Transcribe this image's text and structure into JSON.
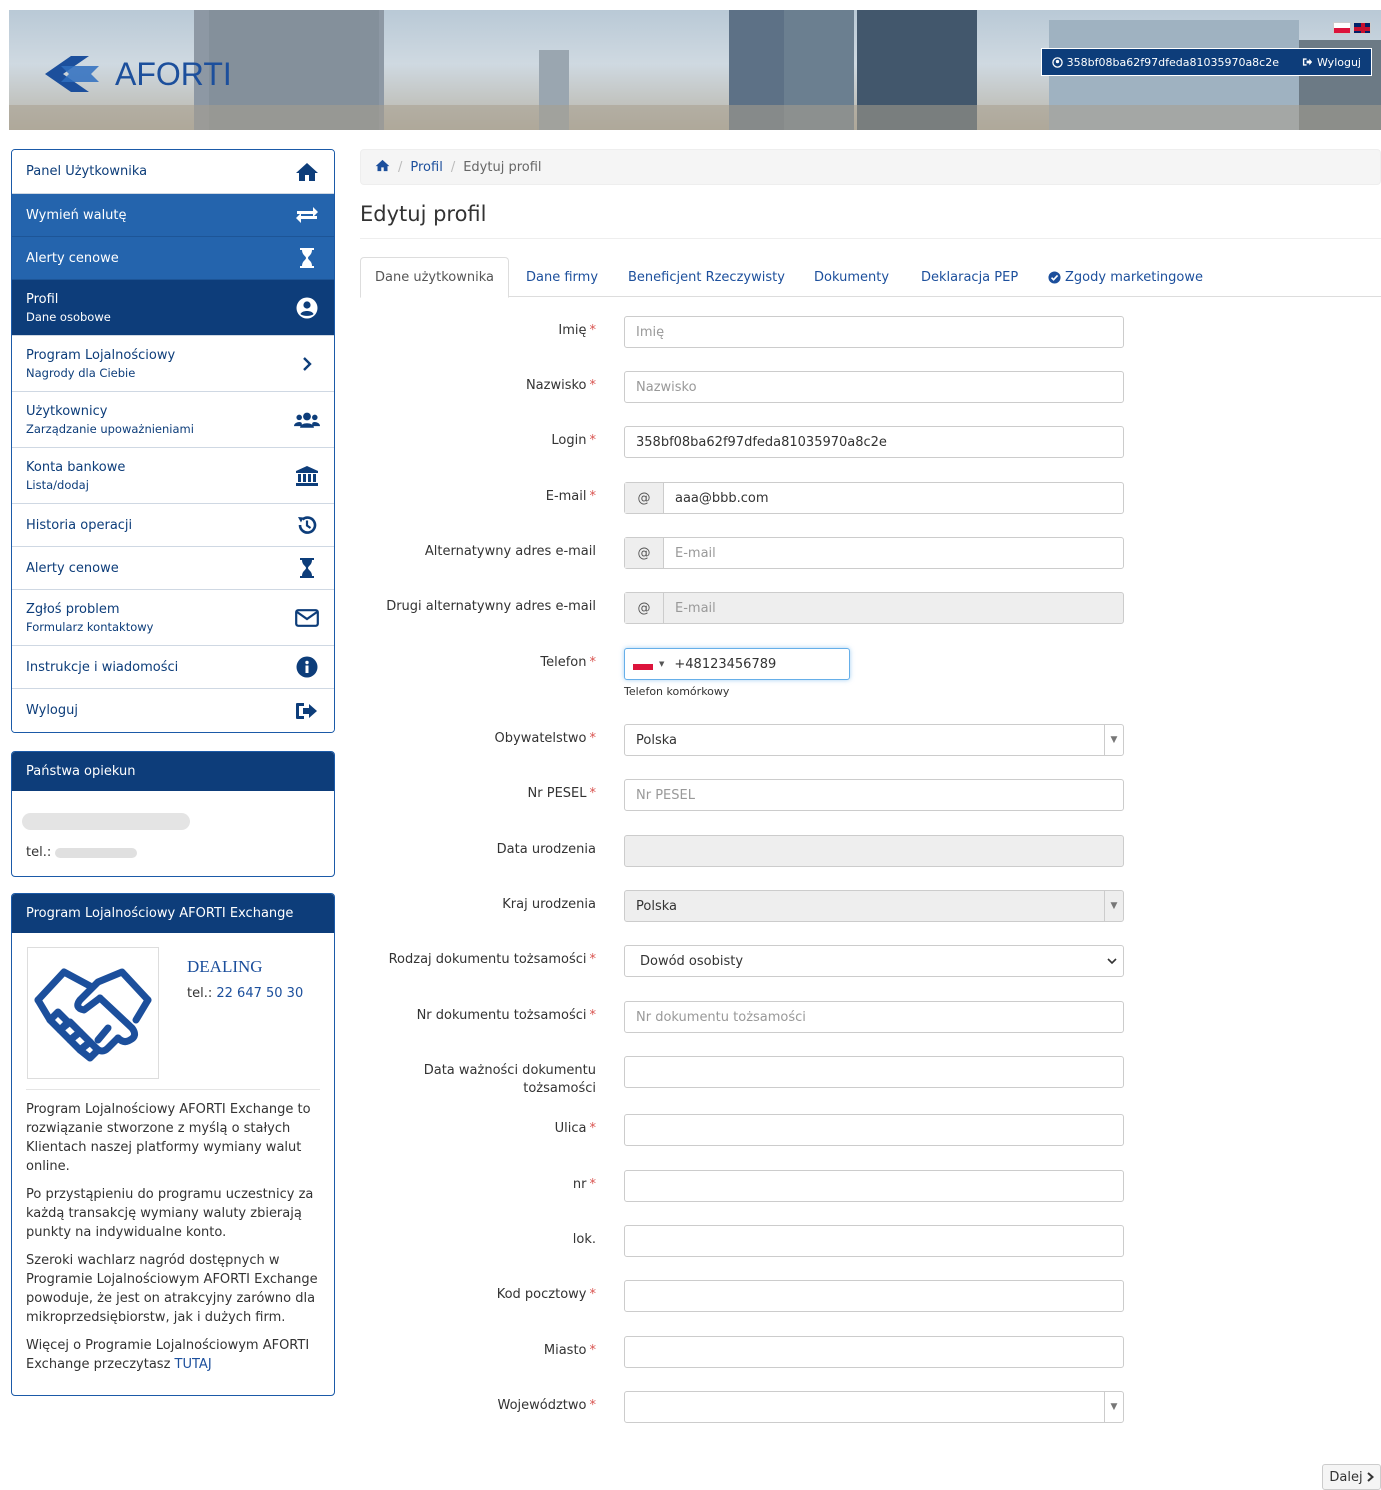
{
  "header": {
    "logo_text": "AFORTI",
    "user_id": "358bf08ba62f97dfeda81035970a8c2e",
    "logout_label": "Wyloguj"
  },
  "menu": {
    "items": [
      {
        "title": "Panel Użytkownika",
        "sub": ""
      },
      {
        "title": "Wymień walutę",
        "sub": ""
      },
      {
        "title": "Alerty cenowe",
        "sub": ""
      },
      {
        "title": "Profil",
        "sub": "Dane osobowe"
      },
      {
        "title": "Program Lojalnościowy",
        "sub": "Nagrody dla Ciebie"
      },
      {
        "title": "Użytkownicy",
        "sub": "Zarządzanie upoważnieniami"
      },
      {
        "title": "Konta bankowe",
        "sub": "Lista/dodaj"
      },
      {
        "title": "Historia operacji",
        "sub": ""
      },
      {
        "title": "Alerty cenowe",
        "sub": ""
      },
      {
        "title": "Zgłoś problem",
        "sub": "Formularz kontaktowy"
      },
      {
        "title": "Instrukcje i wiadomości",
        "sub": ""
      },
      {
        "title": "Wyloguj",
        "sub": ""
      }
    ]
  },
  "advisor": {
    "title": "Państwa opiekun",
    "tel_label": "tel.:"
  },
  "loyalty": {
    "title": "Program Lojalnościowy AFORTI Exchange",
    "dealing": "DEALING",
    "tel_label": "tel.:",
    "tel": "22 647 50 30",
    "p1": "Program Lojalnościowy AFORTI Exchange to rozwiązanie stworzone z myślą o stałych Klientach naszej platformy wymiany walut online.",
    "p2": "Po przystąpieniu do programu uczestnicy za każdą transakcję wymiany waluty zbierają punkty na indywidualne konto.",
    "p3": "Szeroki wachlarz nagród dostępnych w Programie Lojalnościowym AFORTI Exchange powoduje, że jest on atrakcyjny zarówno dla mikroprzedsiębiorstw, jak i dużych firm.",
    "p4_text": "Więcej o Programie Lojalnościowym AFORTI Exchange przeczytasz",
    "p4_link": "TUTAJ"
  },
  "breadcrumb": {
    "profile": "Profil",
    "current": "Edytuj profil"
  },
  "page_title": "Edytuj profil",
  "tabs": [
    "Dane użytkownika",
    "Dane firmy",
    "Beneficjent Rzeczywisty",
    "Dokumenty",
    "Deklaracja PEP",
    "Zgody marketingowe"
  ],
  "form": {
    "first_name": {
      "label": "Imię",
      "placeholder": "Imię"
    },
    "last_name": {
      "label": "Nazwisko",
      "placeholder": "Nazwisko"
    },
    "login": {
      "label": "Login",
      "value": "358bf08ba62f97dfeda81035970a8c2e"
    },
    "email": {
      "label": "E-mail",
      "addon": "@",
      "value": "aaa@bbb.com"
    },
    "alt_email": {
      "label": "Alternatywny adres e-mail",
      "addon": "@",
      "placeholder": "E-mail"
    },
    "alt_email2": {
      "label": "Drugi alternatywny adres e-mail",
      "addon": "@",
      "placeholder": "E-mail"
    },
    "phone": {
      "label": "Telefon",
      "value": "+48123456789",
      "help": "Telefon komórkowy"
    },
    "citizenship": {
      "label": "Obywatelstwo",
      "value": "Polska"
    },
    "pesel": {
      "label": "Nr PESEL",
      "placeholder": "Nr PESEL"
    },
    "birth_date": {
      "label": "Data urodzenia"
    },
    "birth_country": {
      "label": "Kraj urodzenia",
      "value": "Polska"
    },
    "doc_type": {
      "label": "Rodzaj dokumentu tożsamości",
      "value": "Dowód osobisty"
    },
    "doc_number": {
      "label": "Nr dokumentu tożsamości",
      "placeholder": "Nr dokumentu tożsamości"
    },
    "doc_expiry": {
      "label1": "Data ważności dokumentu",
      "label2": "tożsamości"
    },
    "street": {
      "label": "Ulica"
    },
    "house_no": {
      "label": "nr"
    },
    "apt": {
      "label": "lok."
    },
    "postal": {
      "label": "Kod pocztowy"
    },
    "city": {
      "label": "Miasto"
    },
    "province": {
      "label": "Województwo"
    }
  },
  "next_label": "Dalej",
  "colors": {
    "primary": "#0d3d7a",
    "menu_blue": "#2464ad",
    "link": "#1c4f9c",
    "required": "#d9534f"
  }
}
